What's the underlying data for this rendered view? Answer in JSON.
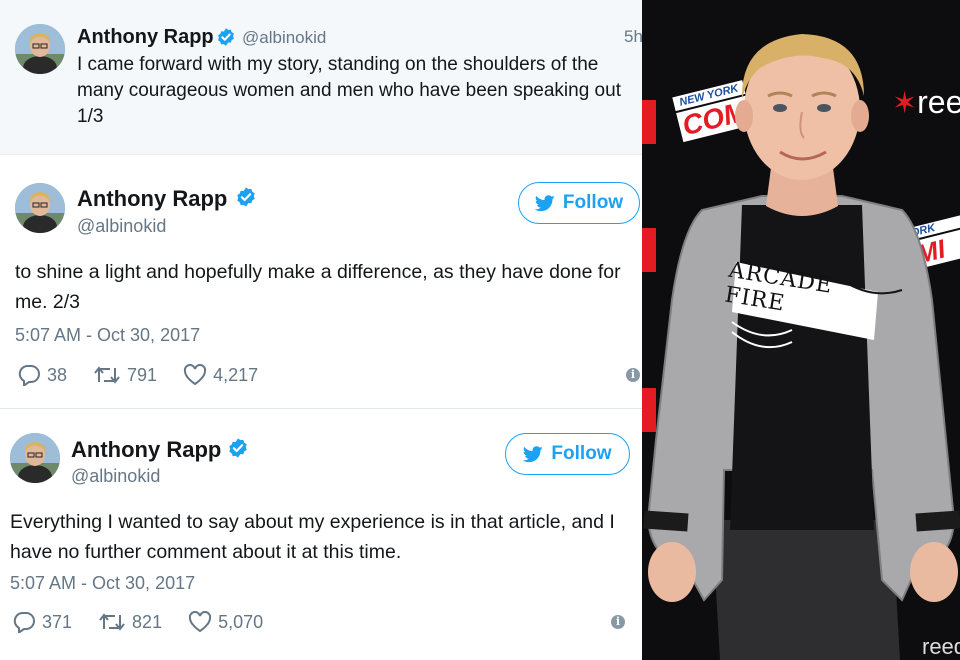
{
  "tweet1": {
    "name": "Anthony Rapp",
    "handle": "@albinokid",
    "time": "5h",
    "text": "I came forward with my story, standing on the shoulders of the many courageous women and men who have been speaking out 1/3"
  },
  "tweet2": {
    "name": "Anthony Rapp",
    "handle": "@albinokid",
    "follow_label": "Follow",
    "text": "to shine a light and hopefully make a difference, as they have done for me. 2/3",
    "date": "5:07 AM - Oct 30, 2017",
    "replies": "38",
    "retweets": "791",
    "likes": "4,217",
    "info": "i"
  },
  "tweet3": {
    "name": "Anthony Rapp",
    "handle": "@albinokid",
    "follow_label": "Follow",
    "text": "Everything I wanted to say about my experience is in that article, and I have no further comment about it at this time.",
    "date": "5:07 AM - Oct 30, 2017",
    "replies": "371",
    "retweets": "821",
    "likes": "5,070",
    "info": "i"
  },
  "photo": {
    "logo_ny": "NEW YORK",
    "logo_com": "COM",
    "logo_reed": "reed",
    "logo_ny_partial": "ORK",
    "logo_com_partial": "MI",
    "logo_reed_partial": "reed",
    "shirt_text": "ARCADE FIRE"
  },
  "colors": {
    "twitter_blue": "#1da1f2",
    "verified_blue": "#1da1f2",
    "secondary_text": "#657786",
    "compact_bg": "#f5f8fa",
    "backdrop": "#0d0d0f",
    "brand_red": "#e31b23"
  },
  "icons": [
    "verified-badge-icon",
    "twitter-bird-icon",
    "reply-icon",
    "retweet-icon",
    "like-heart-icon",
    "info-icon"
  ]
}
